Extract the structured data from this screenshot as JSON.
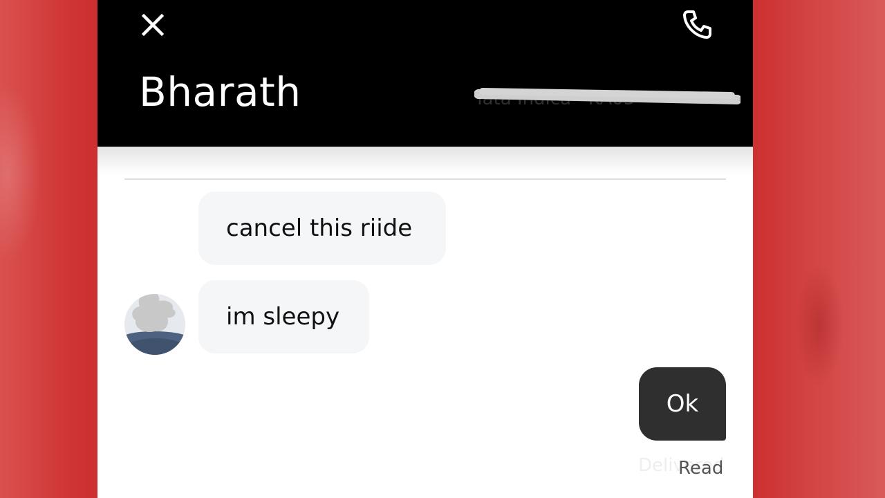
{
  "header": {
    "close_icon": "close-icon",
    "call_icon": "phone-icon",
    "contact_name": "Bharath",
    "vehicle_info_redacted": "Tata Indica · KA05"
  },
  "messages": [
    {
      "direction": "incoming",
      "text": "cancel this riide"
    },
    {
      "direction": "incoming",
      "text": "im sleepy"
    },
    {
      "direction": "outgoing",
      "text": "Ok"
    }
  ],
  "status": {
    "delivered_ghost": "Delivered",
    "read": "Read"
  },
  "colors": {
    "background_red": "#cd2f2f",
    "header_black": "#000000",
    "incoming_bubble": "#f5f6f8",
    "outgoing_bubble": "#2f2f2f"
  }
}
